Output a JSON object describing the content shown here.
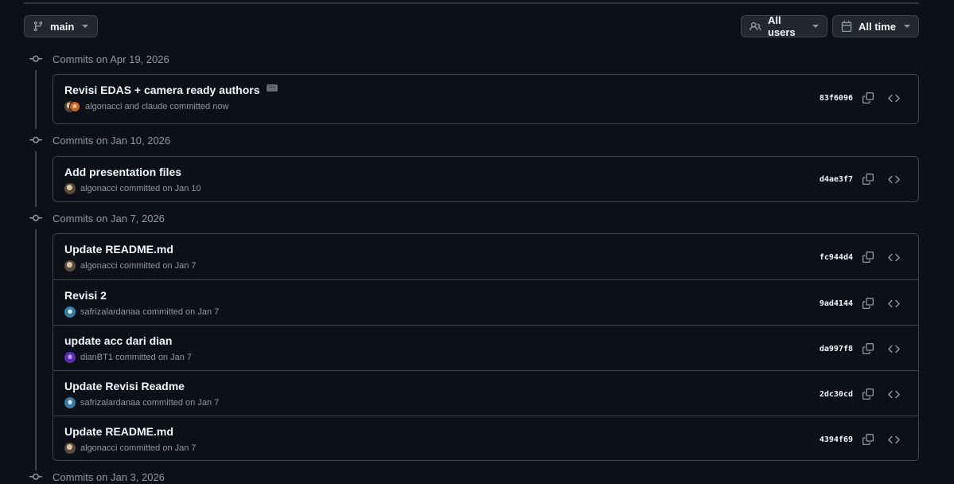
{
  "toolbar": {
    "branch_label": "main",
    "users_label": "All users",
    "time_label": "All time"
  },
  "groups": [
    {
      "header": "Commits on Apr 19, 2026",
      "commits": [
        {
          "title": "Revisi EDAS + camera ready authors",
          "meta": "algonacci and claude committed now",
          "sha": "83f6096",
          "has_ellipsis": true
        }
      ]
    },
    {
      "header": "Commits on Jan 10, 2026",
      "commits": [
        {
          "title": "Add presentation files",
          "meta": "algonacci committed on Jan 10",
          "sha": "d4ae3f7"
        }
      ]
    },
    {
      "header": "Commits on Jan 7, 2026",
      "commits": [
        {
          "title": "Update README.md",
          "meta": "algonacci committed on Jan 7",
          "sha": "fc944d4"
        },
        {
          "title": "Revisi 2",
          "meta": "safrizalardanaa committed on Jan 7",
          "sha": "9ad4144"
        },
        {
          "title": "update acc dari dian",
          "meta": "dianBT1 committed on Jan 7",
          "sha": "da997f8"
        },
        {
          "title": "Update Revisi Readme",
          "meta": "safrizalardanaa committed on Jan 7",
          "sha": "2dc30cd"
        },
        {
          "title": "Update README.md",
          "meta": "algonacci committed on Jan 7",
          "sha": "4394f69"
        }
      ]
    },
    {
      "header": "Commits on Jan 3, 2026",
      "commits": []
    }
  ],
  "colors": {
    "background": "#0d1117",
    "border": "#3d444d",
    "muted_text": "#9198a1",
    "primary_text": "#f0f6fc"
  },
  "icons": {
    "branch": "git-branch-icon",
    "users": "people-icon",
    "time": "calendar-icon",
    "commit_node": "git-commit-icon",
    "copy": "copy-icon",
    "browse": "code-icon"
  }
}
